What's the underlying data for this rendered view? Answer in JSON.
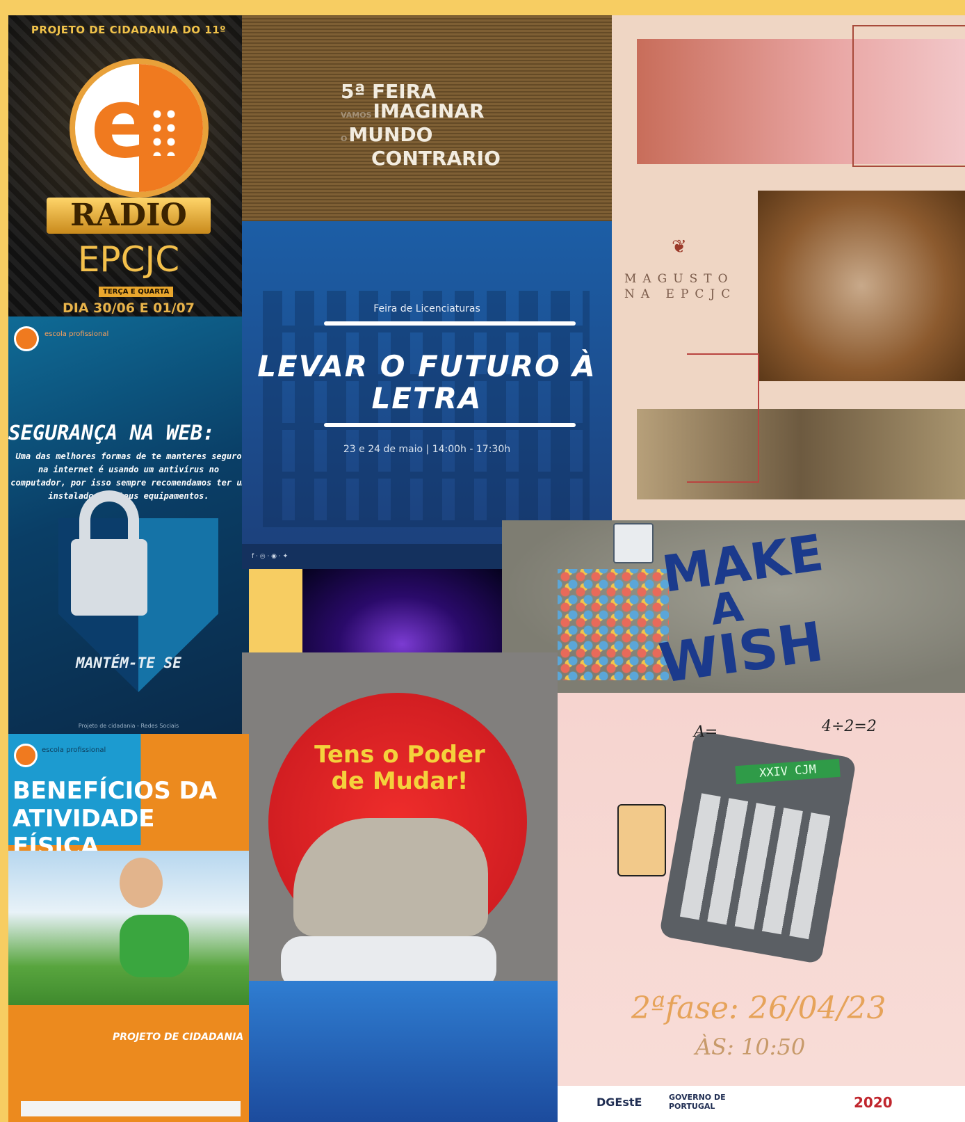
{
  "radio": {
    "project": "PROJETO DE CIDADANIA DO 11º",
    "banner": "RADIO",
    "name": "EPCJC",
    "days": "TERÇA E QUARTA",
    "dates": "DIA 30/06 E 01/07"
  },
  "feira": {
    "line1": "5ª FEIRA",
    "ghost1": "VAMOS",
    "line2": "IMAGINAR",
    "ghost2": "O",
    "line3": "MUNDO",
    "line4": "CONTRARIO"
  },
  "web": {
    "logo_text": "escola profissional",
    "heading": "SEGURANÇA NA WEB:",
    "body": "Uma das melhores formas de te manteres seguro na internet é usando um antivírus no computador, por isso sempre recomendamos ter um instalado nos teus equipamentos.",
    "footer": "MANTÉM-TE SE",
    "small": "Projeto de cidadania - Redes Sociais"
  },
  "levar": {
    "small": "Feira de Licenciaturas",
    "title": "LEVAR O FUTURO À LETRA",
    "date": "23 e 24 de maio | 14:00h - 17:30h"
  },
  "magusto": {
    "line1": "MAGUSTO",
    "line2": "NA EPCJC"
  },
  "wish": {
    "w1": "MAKE",
    "w2": "A",
    "w3": "WISH"
  },
  "poder": {
    "line1": "Tens o Poder",
    "line2": "de Mudar!"
  },
  "ativ": {
    "logo_text": "escola profissional",
    "title_line1": "BENEFÍCIOS DA",
    "title_line2": "ATIVIDADE FÍSICA",
    "project": "PROJETO DE CIDADANIA"
  },
  "calc": {
    "screen": "XXIV CJM",
    "f1": "4÷2=2",
    "f2": "A=",
    "fase": "2ªfase: 26/04/23",
    "as": "ÀS: 10:50",
    "logo1": "DGEstE",
    "logo2": "GOVERNO DE PORTUGAL",
    "logo3": "2020"
  },
  "colors": {
    "background": "#f7cd62",
    "orange": "#f07a1f",
    "levar_blue": "#1c5ea6"
  }
}
